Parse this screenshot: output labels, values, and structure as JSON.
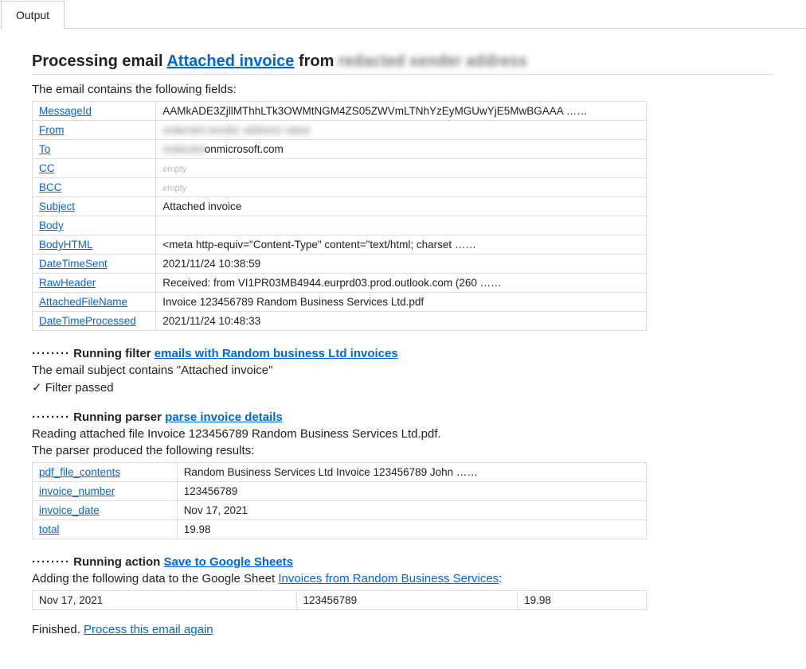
{
  "tab": {
    "label": "Output"
  },
  "title": {
    "prefix": "Processing email ",
    "link": "Attached invoice",
    "mid": " from ",
    "sender_blurred": "redacted sender address"
  },
  "intro": "The email contains the following fields:",
  "email_fields": [
    {
      "key": "MessageId",
      "val": "AAMkADE3ZjllMThhLTk3OWMtNGM4ZS05ZWVmLTNhYzEyMGUwYjE5MwBGAAA ……",
      "blur": false
    },
    {
      "key": "From",
      "val": "redacted sender address value",
      "blur": true
    },
    {
      "key": "To",
      "val_prefix_blur": "redacted",
      "val_suffix": "onmicrosoft.com"
    },
    {
      "key": "CC",
      "val": "empty",
      "empty": true
    },
    {
      "key": "BCC",
      "val": "empty",
      "empty": true
    },
    {
      "key": "Subject",
      "val": "Attached invoice"
    },
    {
      "key": "Body",
      "val": ""
    },
    {
      "key": "BodyHTML",
      "val": "<meta http-equiv=\"Content-Type\" content=\"text/html; charset ……"
    },
    {
      "key": "DateTimeSent",
      "val": "2021/11/24 10:38:59"
    },
    {
      "key": "RawHeader",
      "val": "Received: from VI1PR03MB4944.eurprd03.prod.outlook.com (260 ……"
    },
    {
      "key": "AttachedFileName",
      "val": "Invoice 123456789 Random Business Services Ltd.pdf"
    },
    {
      "key": "DateTimeProcessed",
      "val": "2021/11/24 10:48:33"
    }
  ],
  "filter": {
    "dots": "········",
    "label": "Running filter ",
    "link": "emails with Random business Ltd invoices",
    "line1": "The email subject contains \"Attached invoice\"",
    "passed": "✓ Filter passed"
  },
  "parser": {
    "dots": "········",
    "label": "Running parser ",
    "link": "parse invoice details",
    "line1": "Reading attached file Invoice 123456789 Random Business Services Ltd.pdf.",
    "line2": "The parser produced the following results:",
    "rows": [
      {
        "key": "pdf_file_contents",
        "val": "Random Business Services Ltd Invoice 123456789 John ……"
      },
      {
        "key": "invoice_number",
        "val": "123456789"
      },
      {
        "key": "invoice_date",
        "val": "Nov 17, 2021"
      },
      {
        "key": "total",
        "val": "19.98"
      }
    ]
  },
  "action": {
    "dots": "········",
    "label": "Running action ",
    "link": "Save to Google Sheets",
    "line1_pre": "Adding the following data to the Google Sheet ",
    "line1_link": "Invoices from Random Business Services",
    "line1_post": ":",
    "row": [
      "Nov 17, 2021",
      "123456789",
      "19.98"
    ]
  },
  "finished": {
    "text": "Finished. ",
    "link": "Process this email again"
  }
}
